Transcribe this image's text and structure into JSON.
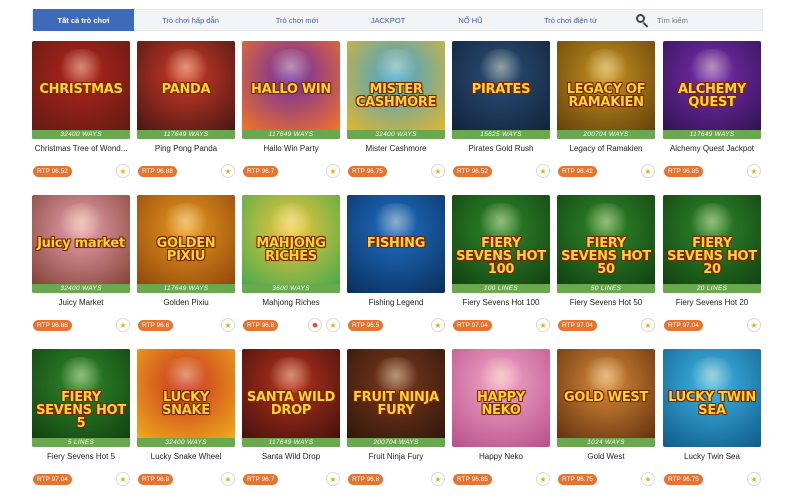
{
  "tabs": [
    {
      "label": "Tất cả trò chơi",
      "active": true
    },
    {
      "label": "Trò chơi hấp dẫn",
      "active": false
    },
    {
      "label": "Trò chơi mới",
      "active": false
    },
    {
      "label": "JACKPOT",
      "active": false
    },
    {
      "label": "NỔ HŨ",
      "active": false
    },
    {
      "label": "Trò chơi điện tử",
      "active": false
    }
  ],
  "search": {
    "placeholder": "Tìm kiếm",
    "icon": "search-icon"
  },
  "games": [
    {
      "name": "Christmas Tree of Wond...",
      "art": "CHRISTMAS",
      "ways": "32400 WAYS",
      "rtp": "RTP 96.52",
      "colors": [
        "#b3241f",
        "#5a1a10"
      ]
    },
    {
      "name": "Ping Pong Panda",
      "art": "PANDA",
      "ways": "117649 WAYS",
      "rtp": "RTP 96.88",
      "colors": [
        "#d23a2a",
        "#3a1410"
      ]
    },
    {
      "name": "Hallo Win Party",
      "art": "HALLO WIN",
      "ways": "117649 WAYS",
      "rtp": "RTP 96.7",
      "colors": [
        "#6b2aa8",
        "#ff7b1a"
      ]
    },
    {
      "name": "Mister Cashmore",
      "art": "MISTER CASHMORE",
      "ways": "32400 WAYS",
      "rtp": "RTP 96.75",
      "colors": [
        "#3aa3d8",
        "#f2b71b"
      ]
    },
    {
      "name": "Pirates Gold Rush",
      "art": "PIRATES",
      "ways": "15625 WAYS",
      "rtp": "RTP 96.52",
      "colors": [
        "#2a4f7a",
        "#0f1f33"
      ]
    },
    {
      "name": "Legacy of Ramakien",
      "art": "LEGACY OF RAMAKIEN",
      "ways": "200704 WAYS",
      "rtp": "RTP 96.42",
      "colors": [
        "#c7931f",
        "#5a3a0a"
      ]
    },
    {
      "name": "Alchemy Quest Jackpot",
      "art": "ALCHEMY QUEST",
      "ways": "117649 WAYS",
      "rtp": "RTP 96.85",
      "colors": [
        "#7a2fb2",
        "#2a0f4a"
      ]
    },
    {
      "name": "Juicy Market",
      "art": "Juicy market",
      "ways": "32400 WAYS",
      "rtp": "RTP 96.88",
      "colors": [
        "#e8a2b0",
        "#7a3a2a"
      ]
    },
    {
      "name": "Golden Pixiu",
      "art": "GOLDEN PIXIU",
      "ways": "117649 WAYS",
      "rtp": "RTP 96.6",
      "colors": [
        "#e89a1f",
        "#8a3f0a"
      ]
    },
    {
      "name": "Mahjong Riches",
      "art": "MAHJONG RICHES",
      "ways": "3600 WAYS",
      "rtp": "RTP 96.8",
      "colors": [
        "#f2c63a",
        "#3aa84f"
      ]
    },
    {
      "name": "Fishing Legend",
      "art": "FISHING",
      "ways": "",
      "rtp": "RTP 96.5",
      "colors": [
        "#1f6fc8",
        "#0a2f5a"
      ]
    },
    {
      "name": "Fiery Sevens Hot 100",
      "art": "FIERY SEVENS HOT 100",
      "ways": "100 LINES",
      "rtp": "RTP 97.04",
      "colors": [
        "#2f8a2a",
        "#0f3a0f"
      ]
    },
    {
      "name": "Fiery Sevens Hot 50",
      "art": "FIERY SEVENS HOT 50",
      "ways": "50 LINES",
      "rtp": "RTP 97.04",
      "colors": [
        "#2f8a2a",
        "#0f3a0f"
      ]
    },
    {
      "name": "Fiery Sevens Hot 20",
      "art": "FIERY SEVENS HOT 20",
      "ways": "20 LINES",
      "rtp": "RTP 97.04",
      "colors": [
        "#2f8a2a",
        "#0f3a0f"
      ]
    },
    {
      "name": "Fiery Sevens Hot 5",
      "art": "FIERY SEVENS HOT 5",
      "ways": "5 LINES",
      "rtp": "RTP 97.04",
      "colors": [
        "#2f8a2a",
        "#0f3a0f"
      ]
    },
    {
      "name": "Lucky Snake Wheel",
      "art": "LUCKY SNAKE",
      "ways": "32400 WAYS",
      "rtp": "RTP 96.8",
      "colors": [
        "#c8321f",
        "#f2b71b"
      ]
    },
    {
      "name": "Santa Wild Drop",
      "art": "SANTA WILD DROP",
      "ways": "117649 WAYS",
      "rtp": "RTP 96.7",
      "colors": [
        "#b8311f",
        "#3a0f0a"
      ]
    },
    {
      "name": "Fruit Ninja Fury",
      "art": "FRUIT NINJA FURY",
      "ways": "200704 WAYS",
      "rtp": "RTP 96.8",
      "colors": [
        "#7a3a1f",
        "#2a1408"
      ]
    },
    {
      "name": "Happy Neko",
      "art": "HAPPY NEKO",
      "ways": "",
      "rtp": "RTP 96.85",
      "colors": [
        "#f2a7c8",
        "#b84f8a"
      ]
    },
    {
      "name": "Gold West",
      "art": "GOLD WEST",
      "ways": "1024 WAYS",
      "rtp": "RTP 96.75",
      "colors": [
        "#d88a3a",
        "#5a2a0a"
      ]
    },
    {
      "name": "Lucky Twin Sea",
      "art": "LUCKY TWIN SEA",
      "ways": "",
      "rtp": "RTP 96.75",
      "colors": [
        "#3fb8e8",
        "#0f5a8a"
      ]
    }
  ],
  "icons": {
    "favorite": "star-icon",
    "hot": "fire-icon"
  },
  "accent": {
    "tab_active": "#3d6bb9",
    "rtp_badge": "#e8732f",
    "ways_bar": "#6aa84f"
  }
}
